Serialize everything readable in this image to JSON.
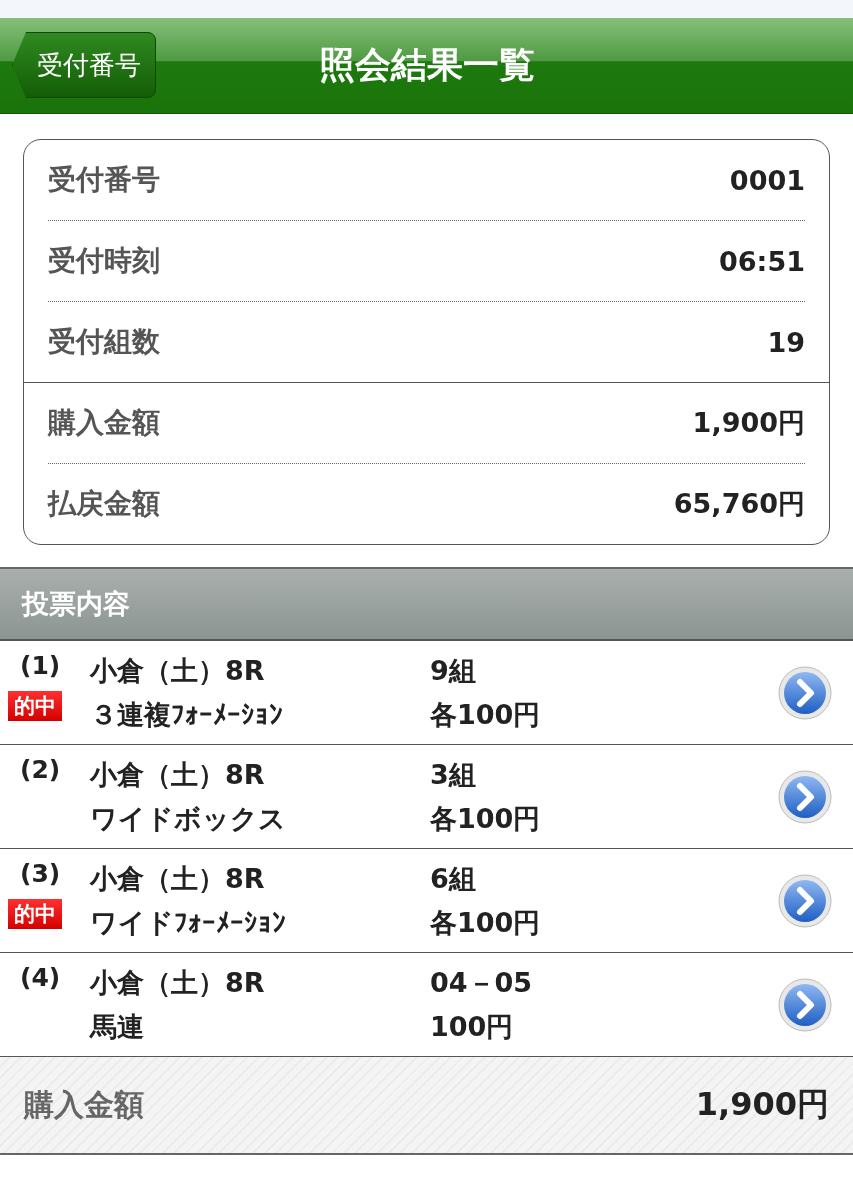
{
  "header": {
    "back_button": "受付番号",
    "title": "照会結果一覧"
  },
  "summary": {
    "groups": [
      [
        {
          "label": "受付番号",
          "value": "0001"
        },
        {
          "label": "受付時刻",
          "value": "06:51"
        },
        {
          "label": "受付組数",
          "value": "19"
        }
      ],
      [
        {
          "label": "購入金額",
          "value": "1,900円"
        },
        {
          "label": "払戻金額",
          "value": "65,760円"
        }
      ]
    ]
  },
  "section_title": "投票内容",
  "bets": [
    {
      "number": "(1)",
      "race": "小倉（土）8R",
      "type": "３連複ﾌｫｰﾒｰｼｮﾝ",
      "count": "9組",
      "amount": "各100円",
      "hit": true,
      "hit_label": "的中"
    },
    {
      "number": "(2)",
      "race": "小倉（土）8R",
      "type": "ワイドボックス",
      "count": "3組",
      "amount": "各100円",
      "hit": false
    },
    {
      "number": "(3)",
      "race": "小倉（土）8R",
      "type": "ワイドﾌｫｰﾒｰｼｮﾝ",
      "count": "6組",
      "amount": "各100円",
      "hit": true,
      "hit_label": "的中"
    },
    {
      "number": "(4)",
      "race": "小倉（土）8R",
      "type": "馬連",
      "count": "04－05",
      "amount": "100円",
      "hit": false
    }
  ],
  "total": {
    "label": "購入金額",
    "value": "1,900円"
  }
}
